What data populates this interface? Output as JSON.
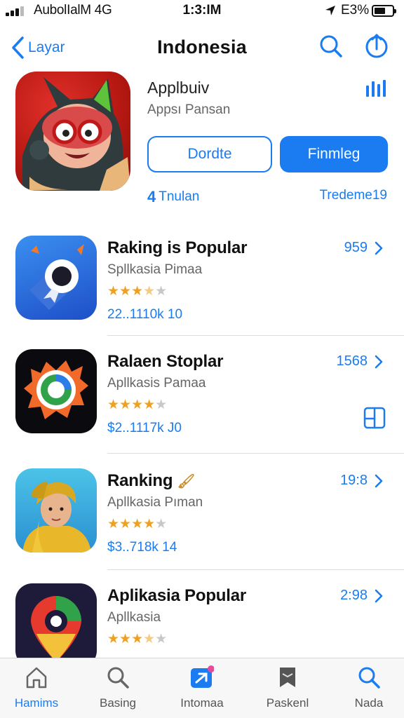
{
  "status_bar": {
    "carrier": "AubolIalM 4G",
    "time": "1:3:IM",
    "battery_pct": "E3%"
  },
  "nav": {
    "back_label": "Layar",
    "title": "Indonesia"
  },
  "hero": {
    "title": "Applbuiv",
    "subtitle": "Appsı Pansan",
    "button_outline": "Dordte",
    "button_solid": "Finmleg",
    "link_left": "Tnulan",
    "link_right": "Tredeme19"
  },
  "list": [
    {
      "name": "Raking is Popular",
      "category": "Spllkasia Pimaa",
      "meta": "22..1110k 10",
      "rank": "959",
      "rating": 3.5
    },
    {
      "name": "Ralaen Stoplar",
      "category": "Apllkasis Pamaa",
      "meta": "$2..1117k J0",
      "rank": "1568",
      "rating": 4
    },
    {
      "name": "Ranking",
      "name_suffix": "🖌",
      "category": "Apllkasia Pıman",
      "meta": "$3..718k 14",
      "rank": "19:8",
      "rating": 4
    },
    {
      "name": "Aplikasia Popular",
      "category": "Apllkasia",
      "meta": "",
      "rank": "2:98",
      "rating": 3.5
    }
  ],
  "tabs": [
    {
      "label": "Hamims",
      "icon": "home-icon",
      "active": true
    },
    {
      "label": "Basing",
      "icon": "search-icon",
      "active": false
    },
    {
      "label": "Intomaa",
      "icon": "apps-icon",
      "active": false
    },
    {
      "label": "Paskenl",
      "icon": "bookmark-icon",
      "active": false
    },
    {
      "label": "Nada",
      "icon": "search-icon",
      "active": false
    }
  ],
  "colors": {
    "accent": "#1a7cf0",
    "star": "#f0a020"
  }
}
